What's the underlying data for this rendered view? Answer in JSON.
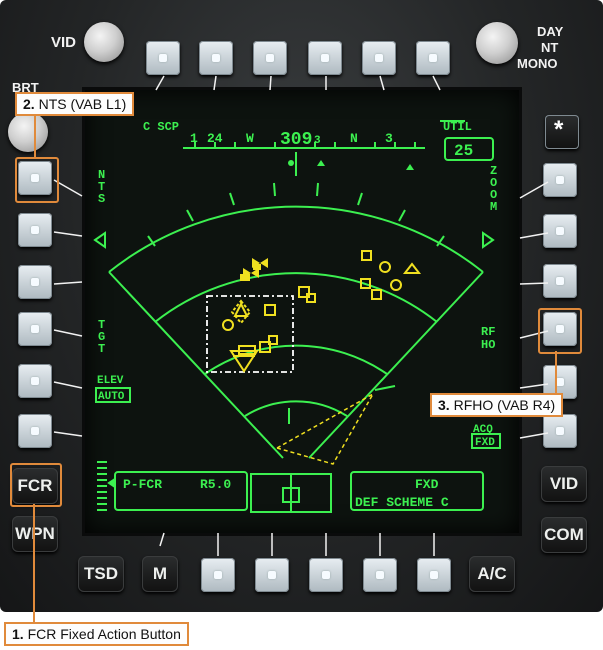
{
  "mpd": {
    "top_labels": {
      "c_scp": "C SCP",
      "util": "UTIL"
    },
    "heading_tape": [
      "1",
      "24",
      "W",
      "309",
      "3",
      "N",
      "3"
    ],
    "heading_value": "309",
    "zoom_value": "25",
    "left_labels": {
      "nts": "N\nT\nS",
      "tgt": "T\nG\nT",
      "elev": "ELEV",
      "elev_mode": "AUTO"
    },
    "right_labels": {
      "zoom": "Z\nO\nO\nM",
      "rfho": "RF\nHO",
      "acq": "ACQ",
      "acq_mode": "FXD"
    },
    "status_left": {
      "mode": "P-FCR",
      "range": "R5.0"
    },
    "status_right": {
      "line1": "FXD",
      "line2": "DEF SCHEME C"
    }
  },
  "fixed_buttons": {
    "vid_top": "VID",
    "fcr": "FCR",
    "wpn": "WPN",
    "tsd": "TSD",
    "m": "M",
    "ac": "A/C",
    "vid_right": "VID",
    "com": "COM",
    "star": "*"
  },
  "panel_labels": {
    "brt": "BRT",
    "day": "DAY",
    "nt": "NT",
    "mono": "MONO"
  },
  "callouts": {
    "c1": {
      "num": "1.",
      "text": " FCR Fixed Action Button"
    },
    "c2": {
      "num": "2.",
      "text": " NTS (VAB L1)"
    },
    "c3": {
      "num": "3.",
      "text": " RFHO (VAB R4)"
    }
  },
  "colors": {
    "symbology": "#3cf050",
    "targets": "#f0e020",
    "callout_border": "#e08a3b"
  }
}
